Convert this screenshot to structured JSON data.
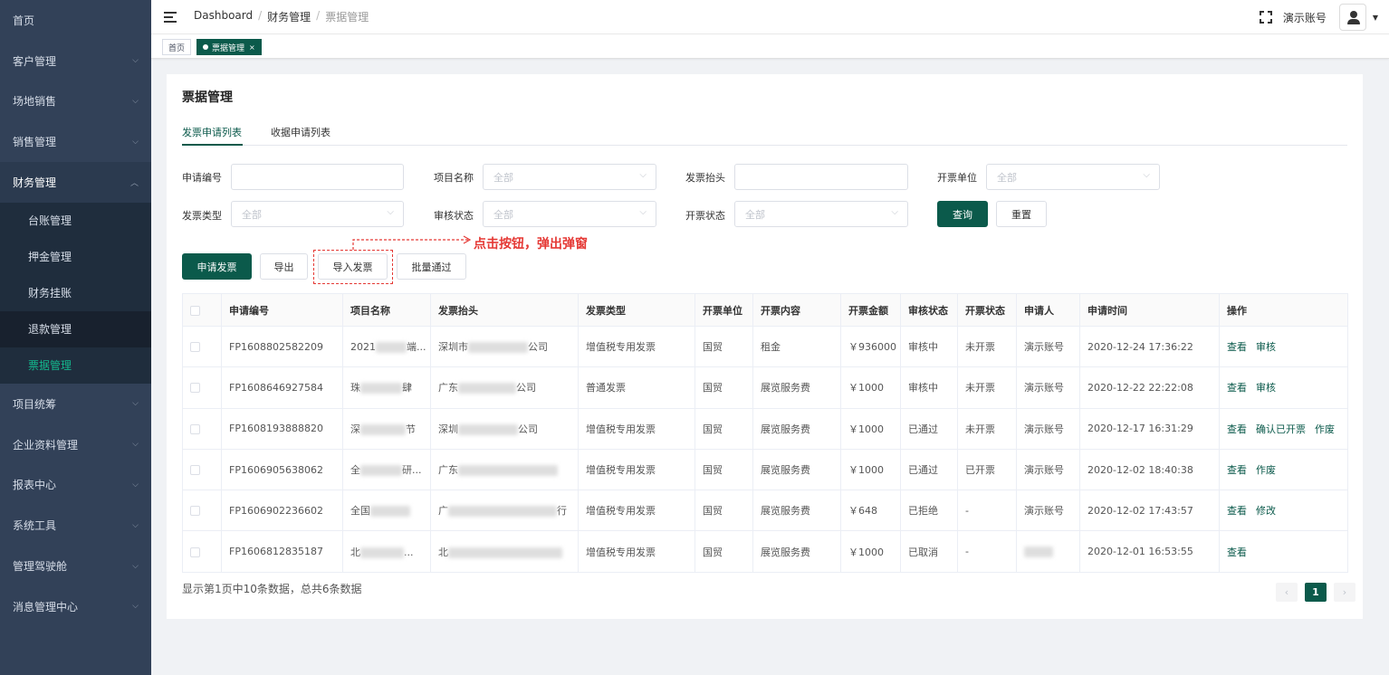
{
  "sidebar": {
    "items": [
      {
        "label": "首页"
      },
      {
        "label": "客户管理"
      },
      {
        "label": "场地销售"
      },
      {
        "label": "销售管理"
      },
      {
        "label": "财务管理"
      }
    ],
    "sub_items": [
      {
        "label": "台账管理"
      },
      {
        "label": "押金管理"
      },
      {
        "label": "财务挂账"
      },
      {
        "label": "退款管理"
      },
      {
        "label": "票据管理"
      }
    ],
    "items_after": [
      {
        "label": "项目统筹"
      },
      {
        "label": "企业资料管理"
      },
      {
        "label": "报表中心"
      },
      {
        "label": "系统工具"
      },
      {
        "label": "管理驾驶舱"
      },
      {
        "label": "消息管理中心"
      }
    ]
  },
  "header": {
    "breadcrumb": [
      "Dashboard",
      "财务管理",
      "票据管理"
    ],
    "separator": "/",
    "user_name": "演示账号"
  },
  "tags": [
    {
      "label": "首页"
    },
    {
      "label": "票据管理",
      "close": "×"
    }
  ],
  "page": {
    "title": "票据管理",
    "tabs": [
      "发票申请列表",
      "收据申请列表"
    ]
  },
  "filters": {
    "labels": [
      "申请编号",
      "项目名称",
      "发票抬头",
      "开票单位",
      "发票类型",
      "审核状态",
      "开票状态"
    ],
    "placeholder": "全部",
    "query_label": "查询",
    "reset_label": "重置"
  },
  "actions": {
    "apply": "申请发票",
    "export": "导出",
    "import": "导入发票",
    "batch": "批量通过",
    "annotation": "点击按钮，弹出弹窗"
  },
  "table": {
    "headers": [
      "申请编号",
      "项目名称",
      "发票抬头",
      "发票类型",
      "开票单位",
      "开票内容",
      "开票金额",
      "审核状态",
      "开票状态",
      "申请人",
      "申请时间",
      "操作"
    ],
    "rows": [
      {
        "id": "FP1608802582209",
        "project_a": "2021",
        "project_b": "端...",
        "title_a": "深圳市",
        "title_b": "公司",
        "type": "增值税专用发票",
        "unit": "国贸",
        "content": "租金",
        "amount": "￥936000",
        "audit": "审核中",
        "invoice": "未开票",
        "applicant": "演示账号",
        "time": "2020-12-24 17:36:22",
        "ops": [
          "查看",
          "审核"
        ]
      },
      {
        "id": "FP1608646927584",
        "project_a": "珠",
        "project_b": "肆",
        "title_a": "广东",
        "title_b": "公司",
        "type": "普通发票",
        "unit": "国贸",
        "content": "展览服务费",
        "amount": "￥1000",
        "audit": "审核中",
        "invoice": "未开票",
        "applicant": "演示账号",
        "time": "2020-12-22 22:22:08",
        "ops": [
          "查看",
          "审核"
        ]
      },
      {
        "id": "FP1608193888820",
        "project_a": "深",
        "project_b": "节",
        "title_a": "深圳",
        "title_b": "公司",
        "type": "增值税专用发票",
        "unit": "国贸",
        "content": "展览服务费",
        "amount": "￥1000",
        "audit": "已通过",
        "invoice": "未开票",
        "applicant": "演示账号",
        "time": "2020-12-17 16:31:29",
        "ops": [
          "查看",
          "确认已开票",
          "作废"
        ]
      },
      {
        "id": "FP1606905638062",
        "project_a": "全",
        "project_b": "研...",
        "title_a": "广东",
        "title_b": "",
        "type": "增值税专用发票",
        "unit": "国贸",
        "content": "展览服务费",
        "amount": "￥1000",
        "audit": "已通过",
        "invoice": "已开票",
        "applicant": "演示账号",
        "time": "2020-12-02 18:40:38",
        "ops": [
          "查看",
          "作废"
        ]
      },
      {
        "id": "FP1606902236602",
        "project_a": "全国",
        "project_b": "",
        "title_a": "广",
        "title_b": "行",
        "type": "增值税专用发票",
        "unit": "国贸",
        "content": "展览服务费",
        "amount": "￥648",
        "audit": "已拒绝",
        "invoice": "-",
        "applicant": "演示账号",
        "time": "2020-12-02 17:43:57",
        "ops": [
          "查看",
          "修改"
        ]
      },
      {
        "id": "FP1606812835187",
        "project_a": "北",
        "project_b": "...",
        "title_a": "北",
        "title_b": "",
        "type": "增值税专用发票",
        "unit": "国贸",
        "content": "展览服务费",
        "amount": "￥1000",
        "audit": "已取消",
        "invoice": "-",
        "applicant": "",
        "time": "2020-12-01 16:53:55",
        "ops": [
          "查看"
        ]
      }
    ]
  },
  "pagination": {
    "summary": "显示第1页中10条数据，总共6条数据",
    "prev": "‹",
    "current": "1",
    "next": "›"
  },
  "colors": {
    "accent": "#0b5a4b",
    "sidebar": "#324158",
    "annotation": "#e53935",
    "active_menu": "#13b88e"
  }
}
